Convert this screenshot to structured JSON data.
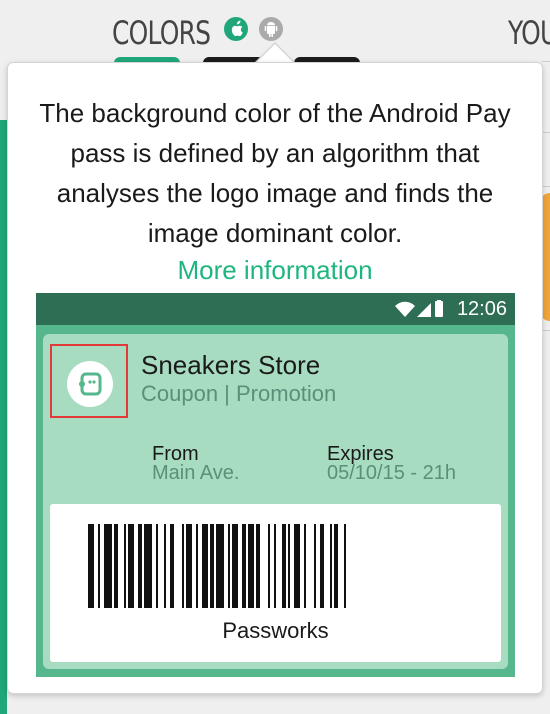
{
  "header": {
    "colors_title": "COLORS",
    "you_title": "YOU",
    "apple_icon": "apple-icon",
    "android_icon": "android-icon"
  },
  "popover": {
    "description": "The background color of the Android Pay pass is defined by an algorithm that analyses the logo image and finds the image dominant color.",
    "link": "More information"
  },
  "phone": {
    "time": "12:06",
    "store_name": "Sneakers Store",
    "store_sub": "Coupon | Promotion",
    "from_label": "From",
    "from_value": "Main Ave.",
    "expires_label": "Expires",
    "expires_value": "05/10/15 - 21h",
    "barcode_text": "Passworks"
  },
  "colors": {
    "accent": "#1fa67a",
    "link": "#1fb57f",
    "card": "#a7dcc1",
    "statusbar": "#2d6e55",
    "highlight": "#e23a3a"
  }
}
